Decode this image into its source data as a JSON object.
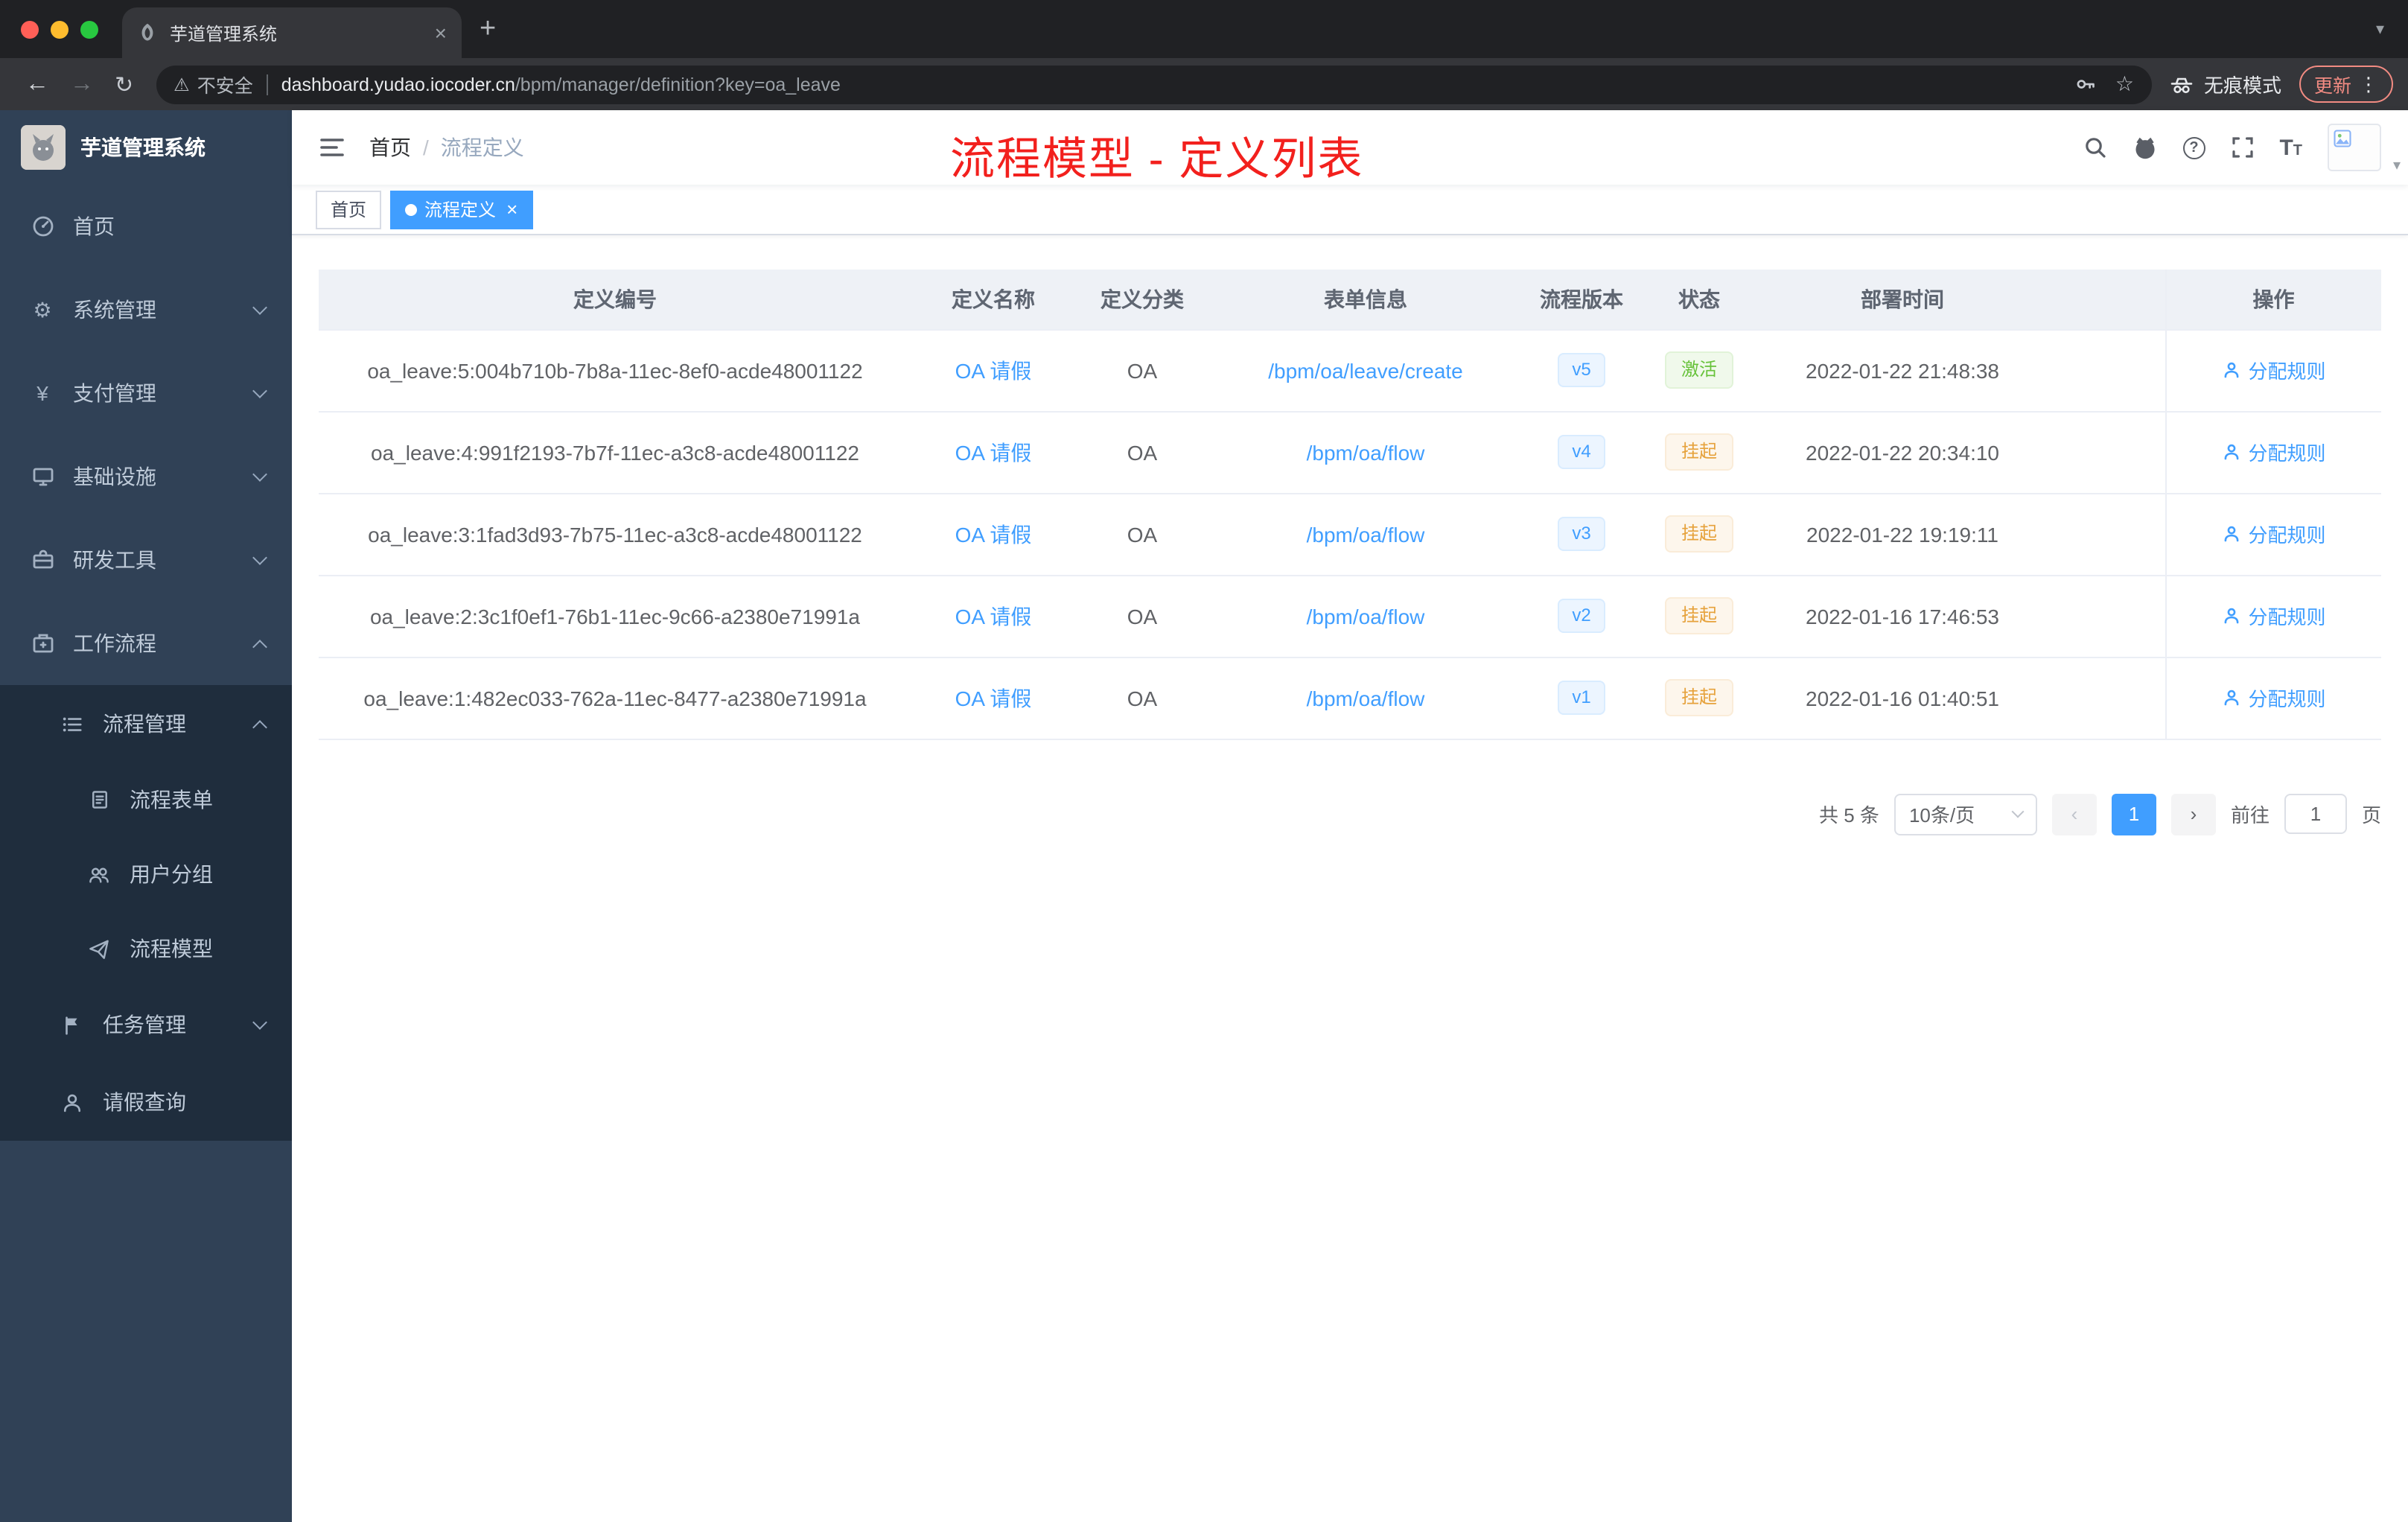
{
  "colors": {
    "accent": "#409eff",
    "annotation_red": "#f2201d",
    "success": "#67c23a",
    "warning": "#e6a23c",
    "sidebar_bg": "#304156",
    "sidebar_sub_bg": "#1f2d3d"
  },
  "browser": {
    "tab_title": "芋道管理系统",
    "security_label": "不安全",
    "url_host": "dashboard.yudao.iocoder.cn",
    "url_path": "/bpm/manager/definition?key=oa_leave",
    "incognito_label": "无痕模式",
    "update_label": "更新"
  },
  "sidebar": {
    "logo_title": "芋道管理系统",
    "items": [
      {
        "label": "首页"
      },
      {
        "label": "系统管理"
      },
      {
        "label": "支付管理"
      },
      {
        "label": "基础设施"
      },
      {
        "label": "研发工具"
      },
      {
        "label": "工作流程"
      },
      {
        "label": "流程管理"
      },
      {
        "label": "流程表单"
      },
      {
        "label": "用户分组"
      },
      {
        "label": "流程模型"
      },
      {
        "label": "任务管理"
      },
      {
        "label": "请假查询"
      }
    ]
  },
  "navbar": {
    "breadcrumb_home": "首页",
    "breadcrumb_current": "流程定义",
    "annotation": "流程模型 - 定义列表"
  },
  "tags": {
    "home": "首页",
    "active": "流程定义"
  },
  "table": {
    "col_id": "定义编号",
    "col_name": "定义名称",
    "col_category": "定义分类",
    "col_form": "表单信息",
    "col_version": "流程版本",
    "col_status": "状态",
    "col_deploy": "部署时间",
    "col_action": "操作",
    "rows": [
      {
        "id": "oa_leave:5:004b710b-7b8a-11ec-8ef0-acde48001122",
        "name": "OA 请假",
        "category": "OA",
        "form": "/bpm/oa/leave/create",
        "version": "v5",
        "status": "激活",
        "deploy_time": "2022-01-22 21:48:38",
        "action": "分配规则"
      },
      {
        "id": "oa_leave:4:991f2193-7b7f-11ec-a3c8-acde48001122",
        "name": "OA 请假",
        "category": "OA",
        "form": "/bpm/oa/flow",
        "version": "v4",
        "status": "挂起",
        "deploy_time": "2022-01-22 20:34:10",
        "action": "分配规则"
      },
      {
        "id": "oa_leave:3:1fad3d93-7b75-11ec-a3c8-acde48001122",
        "name": "OA 请假",
        "category": "OA",
        "form": "/bpm/oa/flow",
        "version": "v3",
        "status": "挂起",
        "deploy_time": "2022-01-22 19:19:11",
        "action": "分配规则"
      },
      {
        "id": "oa_leave:2:3c1f0ef1-76b1-11ec-9c66-a2380e71991a",
        "name": "OA 请假",
        "category": "OA",
        "form": "/bpm/oa/flow",
        "version": "v2",
        "status": "挂起",
        "deploy_time": "2022-01-16 17:46:53",
        "action": "分配规则"
      },
      {
        "id": "oa_leave:1:482ec033-762a-11ec-8477-a2380e71991a",
        "name": "OA 请假",
        "category": "OA",
        "form": "/bpm/oa/flow",
        "version": "v1",
        "status": "挂起",
        "deploy_time": "2022-01-16 01:40:51",
        "action": "分配规则"
      }
    ]
  },
  "pagination": {
    "total": "共 5 条",
    "page_size": "10条/页",
    "page": "1",
    "goto": "前往",
    "goto_value": "1",
    "unit": "页"
  }
}
